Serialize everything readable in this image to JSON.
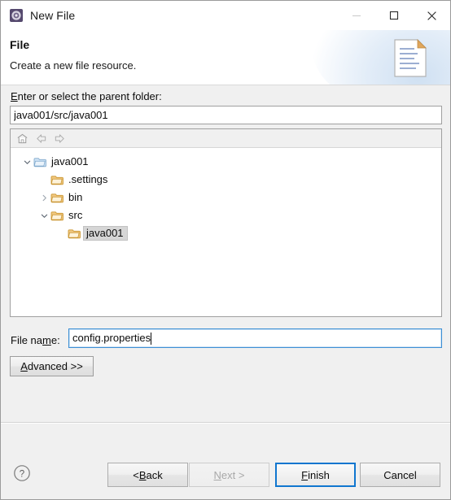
{
  "window": {
    "title": "New File",
    "icon": "eclipse-wizard-icon",
    "controls": {
      "minimize": "minimize-icon",
      "maximize": "maximize-icon",
      "close": "close-icon"
    }
  },
  "header": {
    "title": "File",
    "description": "Create a new file resource.",
    "icon": "new-file-document-icon"
  },
  "parent_folder": {
    "label_prefix": "",
    "label_mnemonic": "E",
    "label_suffix": "nter or select the parent folder:",
    "value": "java001/src/java001"
  },
  "tree_toolbar": {
    "items": [
      {
        "name": "home-folder-icon",
        "title": "Home"
      },
      {
        "name": "back-arrow-icon",
        "title": "Back"
      },
      {
        "name": "forward-arrow-icon",
        "title": "Forward"
      }
    ]
  },
  "tree": {
    "rows": [
      {
        "label": "java001",
        "depth": 0,
        "chevron": "down",
        "icon": "project-folder-icon",
        "selected": false
      },
      {
        "label": ".settings",
        "depth": 1,
        "chevron": "none",
        "icon": "folder-icon",
        "selected": false
      },
      {
        "label": "bin",
        "depth": 1,
        "chevron": "right",
        "icon": "folder-icon",
        "selected": false
      },
      {
        "label": "src",
        "depth": 1,
        "chevron": "down",
        "icon": "folder-icon",
        "selected": false
      },
      {
        "label": "java001",
        "depth": 2,
        "chevron": "none",
        "icon": "folder-icon",
        "selected": true
      }
    ]
  },
  "file_name": {
    "label_prefix": "File na",
    "label_mnemonic": "m",
    "label_suffix": "e:",
    "value": "config.properties"
  },
  "advanced": {
    "mnemonic": "A",
    "suffix": "dvanced >>"
  },
  "buttons": {
    "help": "help-icon",
    "back": {
      "prefix": "< ",
      "mnemonic": "B",
      "suffix": "ack",
      "enabled": true
    },
    "next": {
      "prefix": "",
      "mnemonic": "N",
      "suffix": "ext >",
      "enabled": false
    },
    "finish": {
      "prefix": "",
      "mnemonic": "F",
      "suffix": "inish",
      "enabled": true,
      "default": true
    },
    "cancel": {
      "prefix": "",
      "mnemonic": "",
      "suffix": "Cancel",
      "enabled": true
    }
  },
  "colors": {
    "accent": "#1076cf",
    "focus_border": "#3d8fd4",
    "dialog_bg": "#f0f0f0",
    "folder": "#e8b45a",
    "disabled_text": "#a8a8a8"
  }
}
